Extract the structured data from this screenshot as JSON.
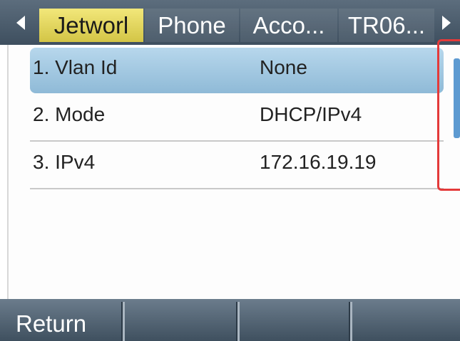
{
  "tabs": [
    {
      "label": "Jetworl",
      "active": true
    },
    {
      "label": "Phone",
      "active": false
    },
    {
      "label": "Acco...",
      "active": false
    },
    {
      "label": "TR06...",
      "active": false
    }
  ],
  "icons": {
    "left": "chevron-left-icon",
    "right": "chevron-right-icon"
  },
  "rows": [
    {
      "key": "1. Vlan Id",
      "value": "None",
      "selected": true
    },
    {
      "key": "2. Mode",
      "value": "DHCP/IPv4",
      "selected": false
    },
    {
      "key": "3. IPv4",
      "value": "172.16.19.19",
      "selected": false
    }
  ],
  "softkeys": [
    {
      "label": "Return"
    },
    {
      "label": ""
    },
    {
      "label": ""
    },
    {
      "label": ""
    }
  ],
  "colors": {
    "active_tab": "#e6da63",
    "selected_row": "#a6cbe4",
    "highlight_box": "#e43a3a",
    "scrollbar": "#5d9ad1"
  }
}
